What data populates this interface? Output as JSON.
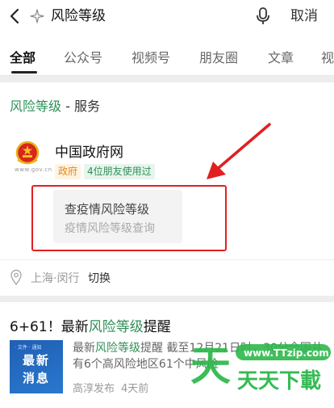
{
  "search": {
    "query": "风险等级",
    "cancel_label": "取消"
  },
  "tabs": [
    {
      "label": "全部",
      "active": true
    },
    {
      "label": "公众号"
    },
    {
      "label": "视频号"
    },
    {
      "label": "朋友圈"
    },
    {
      "label": "文章"
    },
    {
      "label": "视"
    }
  ],
  "service_section": {
    "title_highlight": "风险等级",
    "title_rest": " - 服务",
    "org_name": "中国政府网",
    "emblem_caption": "www.gov.cn",
    "tags": [
      "政府",
      "4位朋友使用过"
    ],
    "service": {
      "title": "查疫情风险等级",
      "subtitle": "疫情风险等级查询"
    },
    "location": "上海·闵行",
    "switch_label": "切换"
  },
  "news": {
    "title_prefix": "6+61！最新",
    "title_highlight": "风险等级",
    "title_suffix": "提醒",
    "thumb_top": "· 文件 · 通知",
    "thumb_line1": "最新",
    "thumb_line2": "消息",
    "body_prefix": "最新",
    "body_highlight": "风险等级",
    "body_rest": "提醒 截至12月21日时，30分全国共有6个高风险地区61个中风险",
    "source": "高淳发布",
    "time": "4天前"
  },
  "watermark": {
    "url": "www.TTzip.com",
    "brand": "天天下載"
  },
  "colors": {
    "highlight_green": "#2f8f57",
    "annotation_red": "#e02020",
    "tag_orange": "#e08a1f"
  }
}
